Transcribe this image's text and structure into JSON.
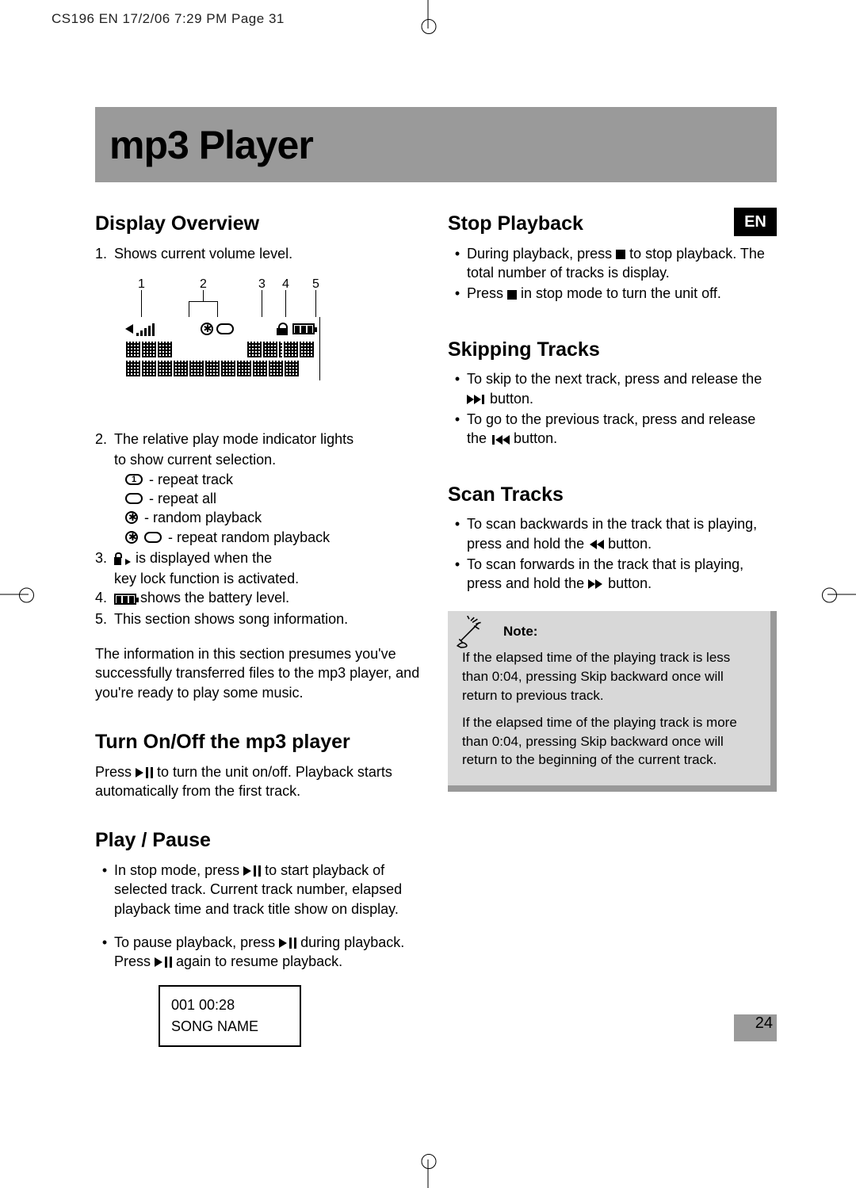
{
  "meta": {
    "header": "CS196 EN  17/2/06  7:29 PM  Page 31"
  },
  "banner": {
    "title": "mp3 Player"
  },
  "lang_badge": "EN",
  "page_number": "24",
  "left": {
    "h_display": "Display Overview",
    "item1_num": "1.",
    "item1": "Shows current volume level.",
    "diag_labels": {
      "n1": "1",
      "n2": "2",
      "n3": "3",
      "n4": "4",
      "n5": "5"
    },
    "item2_num": "2.",
    "item2a": "The relative play mode indicator lights",
    "item2b": "to show current selection.",
    "mode_rep1": " - repeat track",
    "mode_repall": " - repeat all",
    "mode_rand": " - random playback",
    "mode_reprand": " - repeat random playback",
    "item3_num": "3.",
    "item3a": " is displayed when the",
    "item3b": "key lock function is activated.",
    "item4_num": "4.",
    "item4": " shows the battery level.",
    "item5_num": "5.",
    "item5": "This section shows song information.",
    "para": "The information in this section presumes you've successfully transferred files to the mp3 player, and you're ready to play some music.",
    "h_turn": "Turn On/Off the mp3 player",
    "turn_txt_a": "Press ",
    "turn_txt_b": " to turn the unit on/off. Playback starts automatically from the first track.",
    "h_play": "Play / Pause",
    "play_b1a": "In stop mode, press ",
    "play_b1b": " to start playback of selected track. Current track number, elapsed playback time and track title show on display.",
    "play_b2a": "To pause playback, press ",
    "play_b2b": " during playback. Press ",
    "play_b2c": " again to resume playback.",
    "display_box_l1": "001 00:28",
    "display_box_l2": "SONG NAME"
  },
  "right": {
    "h_stop": "Stop Playback",
    "stop_b1a": "During playback, press ",
    "stop_b1b": " to stop playback. The total number of tracks is display.",
    "stop_b2a": "Press ",
    "stop_b2b": " in stop mode to turn the unit off.",
    "h_skip": "Skipping Tracks",
    "skip_b1a": "To skip to the next track, press and release the",
    "skip_b1b": " button.",
    "skip_b2a": "To go to the previous track, press and release the ",
    "skip_b2b": " button.",
    "h_scan": "Scan Tracks",
    "scan_b1a": "To scan backwards in the track that is playing, press and hold the ",
    "scan_b1b": " button.",
    "scan_b2a": "To scan forwards in the track that is playing, press and hold the ",
    "scan_b2b": " button.",
    "note_title": "Note:",
    "note_p1": "If the elapsed time of the playing track is less than 0:04, pressing Skip backward once will return to previous track.",
    "note_p2": "If the elapsed time of the playing track is more than 0:04, pressing Skip backward once will return to the beginning of the current track."
  }
}
